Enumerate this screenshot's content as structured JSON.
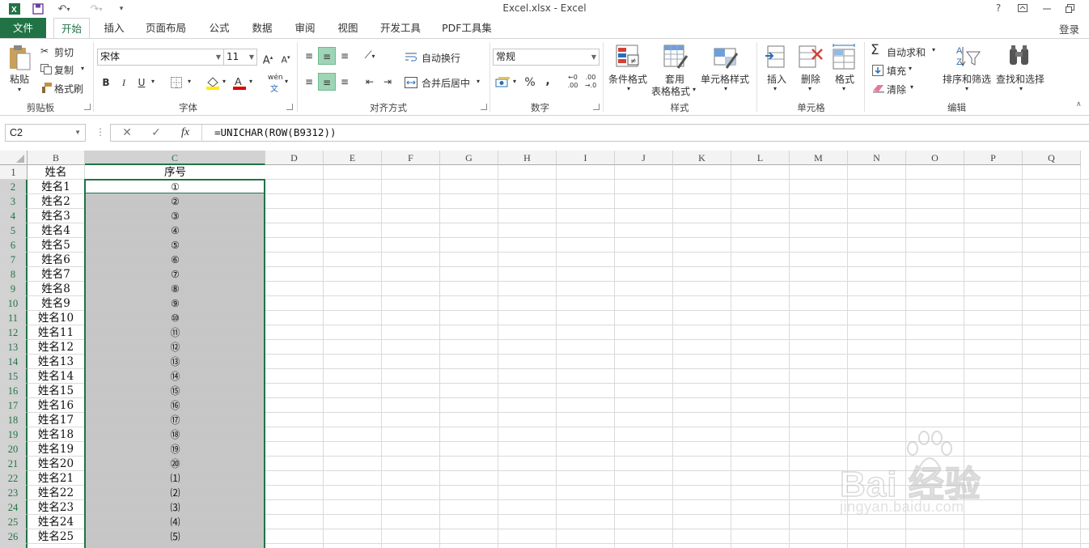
{
  "window": {
    "title": "Excel.xlsx - Excel",
    "help": "?",
    "login": "登录"
  },
  "tabs": [
    "文件",
    "开始",
    "插入",
    "页面布局",
    "公式",
    "数据",
    "审阅",
    "视图",
    "开发工具",
    "PDF工具集"
  ],
  "ribbon": {
    "clipboard": {
      "paste": "粘贴",
      "cut": "剪切",
      "copy": "复制",
      "format_painter": "格式刷",
      "label": "剪贴板"
    },
    "font": {
      "name": "宋体",
      "size": "11",
      "grow": "A",
      "shrink": "A",
      "bold": "B",
      "italic": "I",
      "underline": "U",
      "phonetic": "wén",
      "label": "字体"
    },
    "align": {
      "wrap": "自动换行",
      "merge": "合并后居中",
      "label": "对齐方式"
    },
    "number": {
      "format": "常规",
      "percent": "%",
      "comma": ",",
      "label": "数字"
    },
    "styles": {
      "conditional": "条件格式",
      "table_line1": "套用",
      "table_line2": "表格格式",
      "cell_styles": "单元格样式",
      "label": "样式"
    },
    "cells": {
      "insert": "插入",
      "delete": "删除",
      "format": "格式",
      "label": "单元格"
    },
    "editing": {
      "autosum": "自动求和",
      "fill": "填充",
      "clear": "清除",
      "sort": "排序和筛选",
      "find": "查找和选择",
      "label": "编辑"
    }
  },
  "formula_bar": {
    "name_box": "C2",
    "cancel": "✕",
    "enter": "✓",
    "fx": "fx",
    "formula": "=UNICHAR(ROW(B9312))"
  },
  "columns": [
    "B",
    "C",
    "D",
    "E",
    "F",
    "G",
    "H",
    "I",
    "J",
    "K",
    "L",
    "M",
    "N",
    "O",
    "P",
    "Q"
  ],
  "selected_column": "C",
  "header_row": {
    "row": "1",
    "b": "姓名",
    "c": "序号"
  },
  "rows": [
    {
      "row": "2",
      "b": "姓名1",
      "c": "①"
    },
    {
      "row": "3",
      "b": "姓名2",
      "c": "②"
    },
    {
      "row": "4",
      "b": "姓名3",
      "c": "③"
    },
    {
      "row": "5",
      "b": "姓名4",
      "c": "④"
    },
    {
      "row": "6",
      "b": "姓名5",
      "c": "⑤"
    },
    {
      "row": "7",
      "b": "姓名6",
      "c": "⑥"
    },
    {
      "row": "8",
      "b": "姓名7",
      "c": "⑦"
    },
    {
      "row": "9",
      "b": "姓名8",
      "c": "⑧"
    },
    {
      "row": "10",
      "b": "姓名9",
      "c": "⑨"
    },
    {
      "row": "11",
      "b": "姓名10",
      "c": "⑩"
    },
    {
      "row": "12",
      "b": "姓名11",
      "c": "⑪"
    },
    {
      "row": "13",
      "b": "姓名12",
      "c": "⑫"
    },
    {
      "row": "14",
      "b": "姓名13",
      "c": "⑬"
    },
    {
      "row": "15",
      "b": "姓名14",
      "c": "⑭"
    },
    {
      "row": "16",
      "b": "姓名15",
      "c": "⑮"
    },
    {
      "row": "17",
      "b": "姓名16",
      "c": "⑯"
    },
    {
      "row": "18",
      "b": "姓名17",
      "c": "⑰"
    },
    {
      "row": "19",
      "b": "姓名18",
      "c": "⑱"
    },
    {
      "row": "20",
      "b": "姓名19",
      "c": "⑲"
    },
    {
      "row": "21",
      "b": "姓名20",
      "c": "⑳"
    },
    {
      "row": "22",
      "b": "姓名21",
      "c": "⑴"
    },
    {
      "row": "23",
      "b": "姓名22",
      "c": "⑵"
    },
    {
      "row": "24",
      "b": "姓名23",
      "c": "⑶"
    },
    {
      "row": "25",
      "b": "姓名24",
      "c": "⑷"
    },
    {
      "row": "26",
      "b": "姓名25",
      "c": "⑸"
    }
  ],
  "watermark": {
    "brand": "Bai 经验",
    "url": "jingyan.baidu.com"
  },
  "colors": {
    "accent": "#217346",
    "selection_fill": "#c6c6c6",
    "font_color": "#e00000",
    "highlight": "#ffee00"
  }
}
